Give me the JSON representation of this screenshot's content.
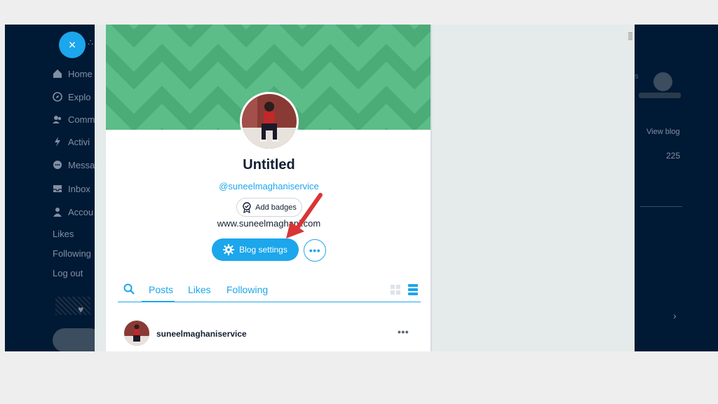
{
  "colors": {
    "accent": "#1ca6ec",
    "banner": "#5cbd89",
    "banner_stripe": "#4bac78",
    "navy": "#001935",
    "arrow": "#d93535"
  },
  "nav": {
    "close_label": "×",
    "items": [
      {
        "label": "Home",
        "icon": "home-icon"
      },
      {
        "label": "Explo",
        "icon": "compass-icon"
      },
      {
        "label": "Comm",
        "icon": "community-icon"
      },
      {
        "label": "Activi",
        "icon": "lightning-icon"
      },
      {
        "label": "Messa",
        "icon": "chat-icon"
      },
      {
        "label": "Inbox",
        "icon": "inbox-icon"
      },
      {
        "label": "Accou",
        "icon": "user-icon"
      }
    ],
    "links": [
      "Likes",
      "Following",
      "Log out"
    ]
  },
  "right_panel": {
    "view_blog": "View blog",
    "count": "225"
  },
  "profile": {
    "title": "Untitled",
    "handle": "@suneelmaghaniservice",
    "add_badges": "Add badges",
    "website": "www.suneelmaghani.com",
    "settings_label": "Blog settings",
    "more_label": "•••"
  },
  "tabs": {
    "items": [
      "Posts",
      "Likes",
      "Following"
    ],
    "active": "Posts"
  },
  "post": {
    "username": "suneelmaghaniservice",
    "more_label": "•••"
  }
}
